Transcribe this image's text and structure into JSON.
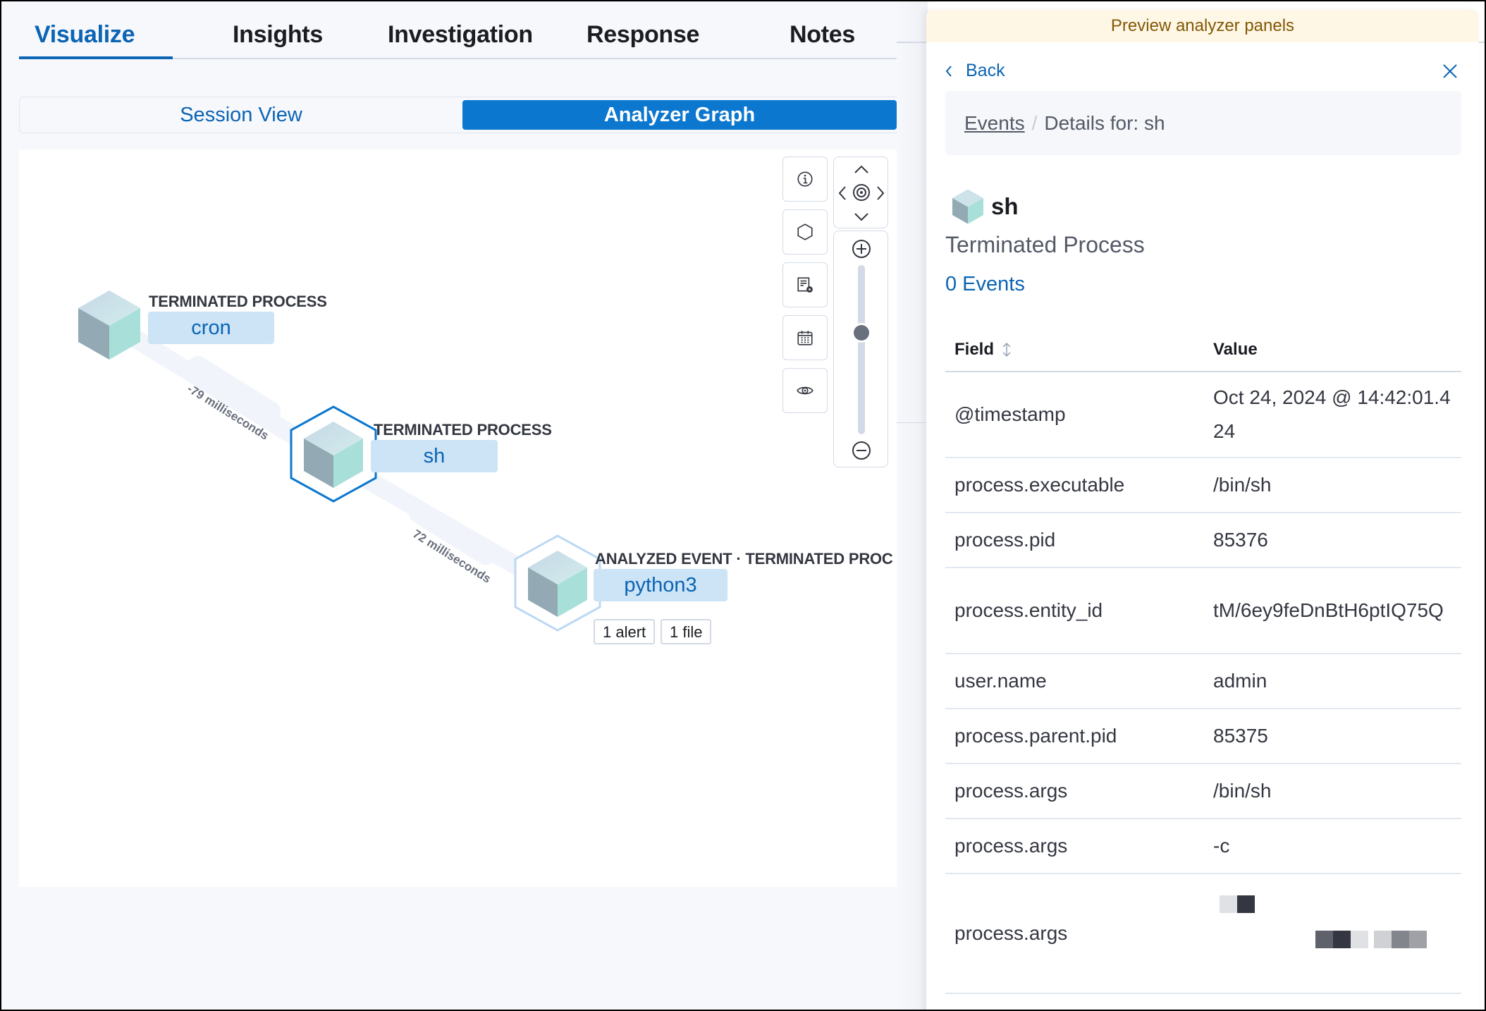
{
  "tabs": [
    {
      "label": "Visualize",
      "active": true
    },
    {
      "label": "Insights",
      "active": false
    },
    {
      "label": "Investigation",
      "active": false
    },
    {
      "label": "Response",
      "active": false
    },
    {
      "label": "Notes",
      "active": false
    }
  ],
  "view_toggle": {
    "options": [
      "Session View",
      "Analyzer Graph"
    ],
    "selected": "Analyzer Graph"
  },
  "graph": {
    "nodes": [
      {
        "type": "TERMINATED PROCESS",
        "name": "cron",
        "selected": false,
        "origin": false,
        "badges": []
      },
      {
        "type": "TERMINATED PROCESS",
        "name": "sh",
        "selected": true,
        "origin": false,
        "badges": []
      },
      {
        "type": "ANALYZED EVENT · TERMINATED PROC",
        "name": "python3",
        "selected": false,
        "origin": true,
        "badges": [
          "1 alert",
          "1 file"
        ]
      }
    ],
    "edges": [
      {
        "from": "cron",
        "to": "sh",
        "label": "-79 milliseconds"
      },
      {
        "from": "sh",
        "to": "python3",
        "label": "72 milliseconds"
      }
    ],
    "controls": {
      "left_buttons": [
        "info-icon",
        "node-legend-icon",
        "sourcerer-settings-icon",
        "date-picker-icon",
        "show-panel-icon"
      ],
      "nav_buttons": [
        "north-icon",
        "west-icon",
        "center-icon",
        "east-icon",
        "south-icon"
      ],
      "zoom_in": "plus-icon",
      "zoom_out": "minus-icon",
      "zoom_level_fraction": 0.4
    }
  },
  "flyout": {
    "banner": "Preview analyzer panels",
    "back_label": "Back",
    "breadcrumb": {
      "link": "Events",
      "current": "Details for: sh"
    },
    "process_name": "sh",
    "process_state": "Terminated Process",
    "events_link": "0 Events",
    "table": {
      "headers": {
        "field": "Field",
        "value": "Value"
      },
      "rows": [
        {
          "field": "@timestamp",
          "value": "Oct 24, 2024 @ 14:42:01.424"
        },
        {
          "field": "process.executable",
          "value": "/bin/sh"
        },
        {
          "field": "process.pid",
          "value": "85376"
        },
        {
          "field": "process.entity_id",
          "value": "tM/6ey9feDnBtH6ptIQ75Q"
        },
        {
          "field": "user.name",
          "value": "admin"
        },
        {
          "field": "process.parent.pid",
          "value": "85375"
        },
        {
          "field": "process.args",
          "value": "/bin/sh"
        },
        {
          "field": "process.args",
          "value": "-c"
        },
        {
          "field": "process.args",
          "value": "[redacted]"
        }
      ]
    }
  },
  "colors": {
    "accent": "#0b64b4",
    "primary_button": "#0b77cf",
    "banner_bg": "#fef7e6",
    "banner_text": "#825803",
    "node_label_bg": "#cce4f5"
  }
}
